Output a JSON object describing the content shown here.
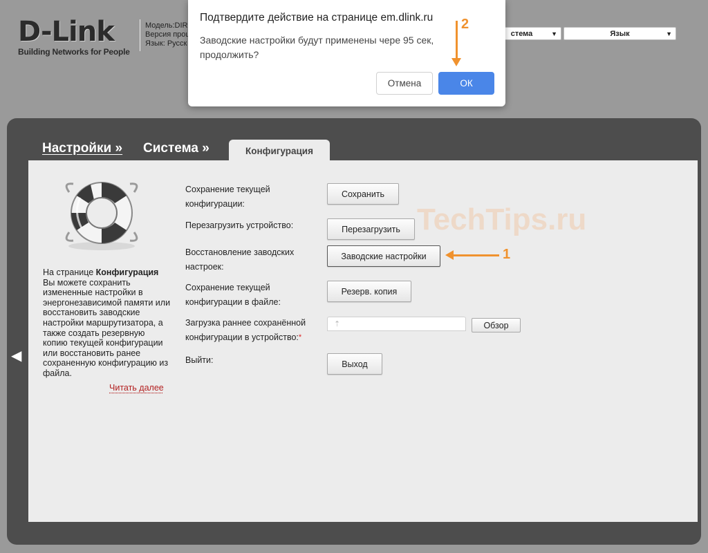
{
  "header": {
    "logo": "D-Link",
    "tagline": "Building Networks for People",
    "model_lines": [
      "Модель:DIR",
      "Версия прош",
      "Язык: Русск"
    ],
    "system_select": "стема",
    "language_select": "Язык"
  },
  "dialog": {
    "title": "Подтвердите действие на странице em.dlink.ru",
    "message": "Заводские настройки будут применены чере 95 сек, продолжить?",
    "cancel_label": "Отмена",
    "ok_label": "ОК"
  },
  "breadcrumb": {
    "settings": "Настройки »",
    "system": "Система »",
    "current_tab": "Конфигурация"
  },
  "sidebar": {
    "desc_prefix": "На странице ",
    "desc_bold": "Конфигурация",
    "desc_rest": " Вы можете сохранить измененные настройки в энергонезависимой памяти или восстановить заводские настройки маршрутизатора, а также создать резервную копию текущей конфигурации или восстановить ранее сохраненную конфигурацию из файла.",
    "read_more": "Читать далее"
  },
  "actions": {
    "save_label": "Сохранение текущей конфигурации:",
    "save_button": "Сохранить",
    "reboot_label": "Перезагрузить устройство:",
    "reboot_button": "Перезагрузить",
    "factory_label": "Восстановление заводских настроек:",
    "factory_button": "Заводские настройки",
    "backup_label": "Сохранение текущей конфигурации в файле:",
    "backup_button": "Резерв. копия",
    "upload_label": "Загрузка раннее сохранённой конфигурации в устройство:",
    "upload_required_mark": "*",
    "browse_button": "Обзор",
    "logout_label": "Выйти:",
    "logout_button": "Выход"
  },
  "annotations": {
    "step1": "1",
    "step2": "2",
    "watermark": "TechTips.ru",
    "color": "#f0922e"
  }
}
